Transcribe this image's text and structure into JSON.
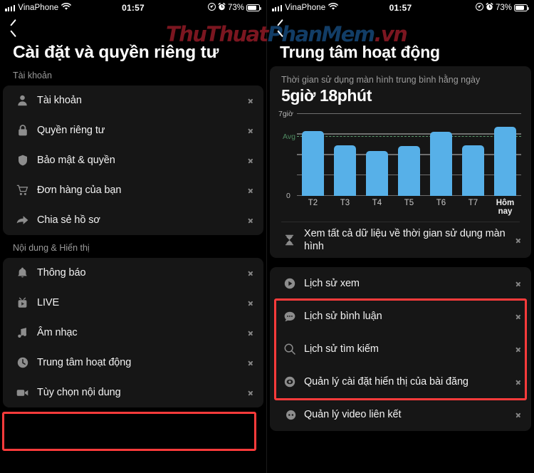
{
  "statusbar": {
    "carrier": "VinaPhone",
    "time": "01:57",
    "battery_percent": "73%",
    "signal_icon": "signal-bars-icon",
    "wifi_icon": "wifi-icon",
    "location_icon": "location-arrow-icon",
    "alarm_icon": "alarm-clock-icon",
    "battery_icon": "battery-icon"
  },
  "watermark": {
    "part1": "ThuThuat",
    "part2": "PhanMem",
    "part3": ".vn"
  },
  "left_screen": {
    "back_icon": "back-chevron-icon",
    "title": "Cài đặt và quyền riêng tư",
    "sections": [
      {
        "label": "Tài khoản",
        "items": [
          {
            "icon": "person-icon",
            "label": "Tài khoản"
          },
          {
            "icon": "lock-icon",
            "label": "Quyền riêng tư"
          },
          {
            "icon": "shield-icon",
            "label": "Bảo mật & quyền"
          },
          {
            "icon": "cart-icon",
            "label": "Đơn hàng của bạn"
          },
          {
            "icon": "share-icon",
            "label": "Chia sẻ hồ sơ"
          }
        ]
      },
      {
        "label": "Nội dung & Hiển thị",
        "items": [
          {
            "icon": "bell-icon",
            "label": "Thông báo"
          },
          {
            "icon": "tv-icon",
            "label": "LIVE"
          },
          {
            "icon": "music-note-icon",
            "label": "Âm nhạc"
          },
          {
            "icon": "clock-icon",
            "label": "Trung tâm hoạt động"
          },
          {
            "icon": "video-camera-icon",
            "label": "Tùy chọn nội dung"
          }
        ]
      }
    ]
  },
  "right_screen": {
    "back_icon": "back-chevron-icon",
    "title": "Trung tâm hoạt động",
    "screen_time": {
      "subtitle": "Thời gian sử dụng màn hình trung bình hằng ngày",
      "value": "5giờ 18phút",
      "view_all": {
        "icon": "hourglass-icon",
        "label": "Xem tất cả dữ liệu về thời gian sử dụng màn hình"
      }
    },
    "history_items": [
      {
        "icon": "play-circle-icon",
        "label": "Lịch sử xem"
      },
      {
        "icon": "comment-icon",
        "label": "Lịch sử bình luận"
      },
      {
        "icon": "search-icon",
        "label": "Lịch sử tìm kiếm"
      }
    ],
    "manage_items": [
      {
        "icon": "eye-icon",
        "label": "Quản lý cài đặt hiển thị của bài đăng"
      },
      {
        "icon": "linked-video-icon",
        "label": "Quản lý video liên kết"
      }
    ]
  },
  "chart_data": {
    "type": "bar",
    "title": "Thời gian sử dụng màn hình trung bình hằng ngày",
    "categories": [
      "T2",
      "T3",
      "T4",
      "T5",
      "T6",
      "T7",
      "Hôm nay"
    ],
    "values": [
      5.55,
      4.35,
      3.85,
      4.3,
      5.5,
      4.35,
      5.9
    ],
    "value_pct": [
      79,
      62,
      55,
      61,
      78,
      62,
      84
    ],
    "ylabel": "",
    "xlabel": "",
    "ylim": [
      0,
      7
    ],
    "ytick_labels": [
      "7giờ",
      "0"
    ],
    "average_label": "Avg",
    "average_value": 5.3,
    "average_pct": 72,
    "gridlines_pct": [
      0,
      25,
      50,
      75,
      100
    ],
    "grid": true,
    "legend": "none",
    "bar_color": "#57b0e8",
    "avg_line_color": "#5b9c6e"
  },
  "highlights": {
    "color": "#ff3b3b"
  }
}
